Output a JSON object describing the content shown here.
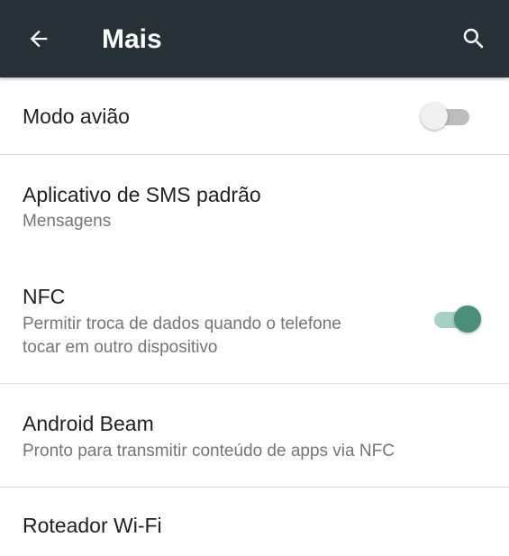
{
  "toolbar": {
    "title": "Mais",
    "back_icon": "arrow-back-icon",
    "search_icon": "search-icon",
    "background": "#263238"
  },
  "items": [
    {
      "title": "Modo avião",
      "toggle": "off"
    },
    {
      "title": "Aplicativo de SMS padrão",
      "subtitle": "Mensagens"
    },
    {
      "title": "NFC",
      "subtitle_line1": "Permitir troca de dados quando o telefone",
      "subtitle_line2": "tocar em outro dispositivo",
      "toggle": "on"
    },
    {
      "title": "Android Beam",
      "subtitle": "Pronto para transmitir conteúdo de apps via NFC"
    },
    {
      "title": "Roteador Wi-Fi"
    }
  ],
  "colors": {
    "accent": "#4a8f7d",
    "accent_track": "#a7cfc6",
    "divider": "#e0e0e0"
  }
}
